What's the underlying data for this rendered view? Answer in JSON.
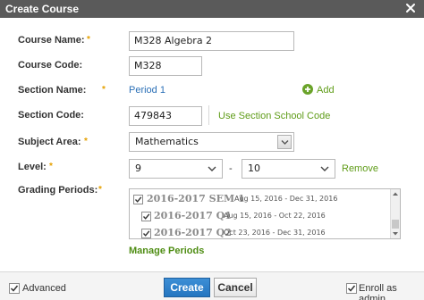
{
  "dialog": {
    "title": "Create Course"
  },
  "fields": {
    "course_name": {
      "label": "Course Name:",
      "required": "*",
      "value": "M328 Algebra 2"
    },
    "course_code": {
      "label": "Course Code:",
      "value": "M328"
    },
    "section_name": {
      "label": "Section Name:",
      "required": "*",
      "value": "Period 1",
      "add_label": "Add"
    },
    "section_code": {
      "label": "Section Code:",
      "value": "479843",
      "link": "Use Section School Code"
    },
    "subject_area": {
      "label": "Subject Area:",
      "required": "*",
      "value": "Mathematics"
    },
    "level": {
      "label": "Level:",
      "required": "*",
      "from": "9",
      "separator": "-",
      "to": "10",
      "remove_label": "Remove"
    },
    "grading_periods": {
      "label": "Grading Periods:",
      "required": "*",
      "items": [
        {
          "name": "2016-2017 SEM 1",
          "dates": "Aug 15, 2016 - Dec 31, 2016",
          "checked": true
        },
        {
          "name": "2016-2017 Q1",
          "dates": "Aug 15, 2016 - Oct 22, 2016",
          "checked": true
        },
        {
          "name": "2016-2017 Q2",
          "dates": "Oct 23, 2016 - Dec 31, 2016",
          "checked": true
        }
      ],
      "manage_label": "Manage Periods"
    }
  },
  "footer": {
    "advanced_label": "Advanced",
    "create_label": "Create",
    "cancel_label": "Cancel",
    "enroll_admin_label": "Enroll as admin"
  },
  "colors": {
    "titlebar": "#5a5a5a",
    "required": "#e5a000",
    "link_blue": "#2a6fb6",
    "link_green": "#5f9c18",
    "primary_button": "#2475c0"
  }
}
